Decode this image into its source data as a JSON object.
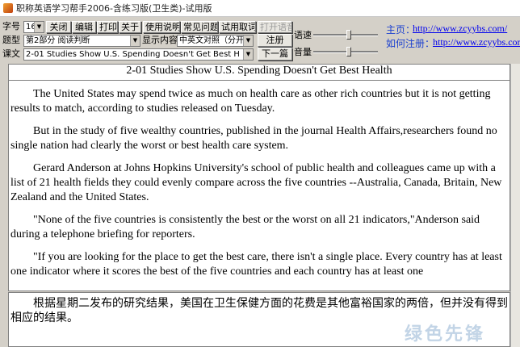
{
  "window": {
    "title": "职称英语学习帮手2006-含练习版(卫生类)-试用版"
  },
  "toolbar": {
    "font_size_label": "字号",
    "font_size_value": "16",
    "buttons": [
      "关闭",
      "编辑",
      "打印",
      "关于",
      "使用说明",
      "常见问题",
      "试用取词"
    ],
    "open_audio": "打开语音",
    "register": "注册",
    "next": "下一篇",
    "category_label": "题型",
    "category_value": "第2部分  阅读判断",
    "display_label": "显示内容",
    "display_value": "中英文对照（分开",
    "lesson_label": "课文",
    "lesson_value": "2-01  Studies Show U.S. Spending Doesn't Get Best H",
    "rate_label": "语速",
    "volume_label": "音量",
    "rate_level": 0.55,
    "volume_level": 0.55
  },
  "links": {
    "home_label": "主页：",
    "home_url": "http://www.zcyybs.com/",
    "register_label": "如何注册：",
    "register_url": "http://www.zcyybs.com/"
  },
  "article": {
    "title": "2-01  Studies Show U.S. Spending Doesn't Get Best Health",
    "paragraphs": [
      "The United States may spend twice as much on health care as other rich countries but it is not getting results to match, according to studies released on Tuesday.",
      "But in the study of five wealthy countries, published in the journal Health Affairs,researchers found no single nation had clearly the worst or best health care system.",
      "Gerard Anderson at Johns Hopkins University's school of public health and colleagues came up with a list of 21 health fields they could evenly compare across the five countries --Australia, Canada, Britain, New Zealand and the United States.",
      "\"None of the five countries is consistently the best or the worst on all 21 indicators,\"Anderson said during a telephone briefing for reporters.",
      "\"If you are looking for the place to get the best care, there isn't a single place. Every country has at least one indicator where it scores the best of the five countries and each country has at least one"
    ]
  },
  "translation": {
    "text": "根据星期二发布的研究结果，美国在卫生保健方面的花费是其他富裕国家的两倍，但并没有得到相应的结果。"
  },
  "watermark": "绿色先锋"
}
